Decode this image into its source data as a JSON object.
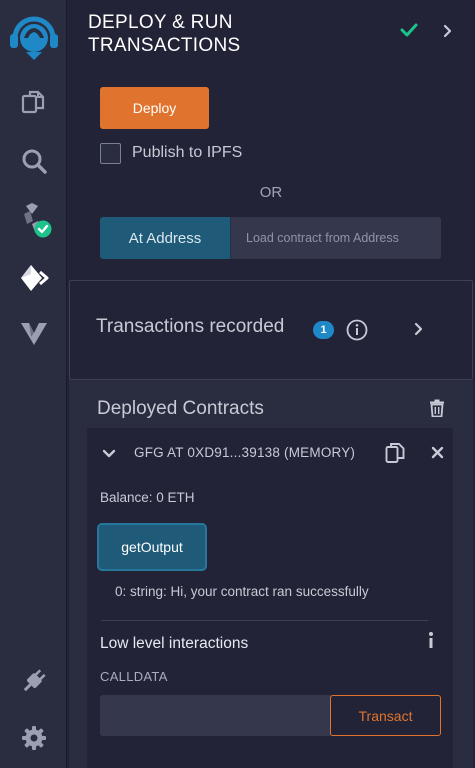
{
  "sidebar": {
    "items": [
      {
        "icon": "remix-logo-icon"
      },
      {
        "icon": "file-explorer-icon"
      },
      {
        "icon": "search-icon"
      },
      {
        "icon": "solidity-compiler-icon"
      },
      {
        "icon": "deploy-run-icon"
      },
      {
        "icon": "verify-icon"
      },
      {
        "icon": "plugin-manager-icon"
      },
      {
        "icon": "settings-icon"
      }
    ]
  },
  "header": {
    "title": "DEPLOY & RUN\nTRANSACTIONS"
  },
  "deploy": {
    "deploy_label": "Deploy",
    "publish_ipfs_label": "Publish to IPFS",
    "publish_ipfs_checked": false,
    "or_label": "OR",
    "at_address_label": "At Address",
    "address_placeholder": "Load contract from Address"
  },
  "transactions": {
    "label": "Transactions recorded",
    "count": "1"
  },
  "deployed": {
    "title": "Deployed Contracts",
    "contract": {
      "name": "GFG AT 0XD91...39138 (MEMORY)",
      "balance": "Balance: 0 ETH",
      "function_label": "getOutput",
      "output": "0: string: Hi, your contract ran successfully",
      "low_level_title": "Low level interactions",
      "calldata_label": "CALLDATA",
      "calldata_value": "",
      "transact_label": "Transact"
    }
  },
  "colors": {
    "accent_orange": "#e0742f",
    "accent_blue": "#1f5b78",
    "success_green": "#1cc38a",
    "badge_blue": "#1f89c8"
  }
}
